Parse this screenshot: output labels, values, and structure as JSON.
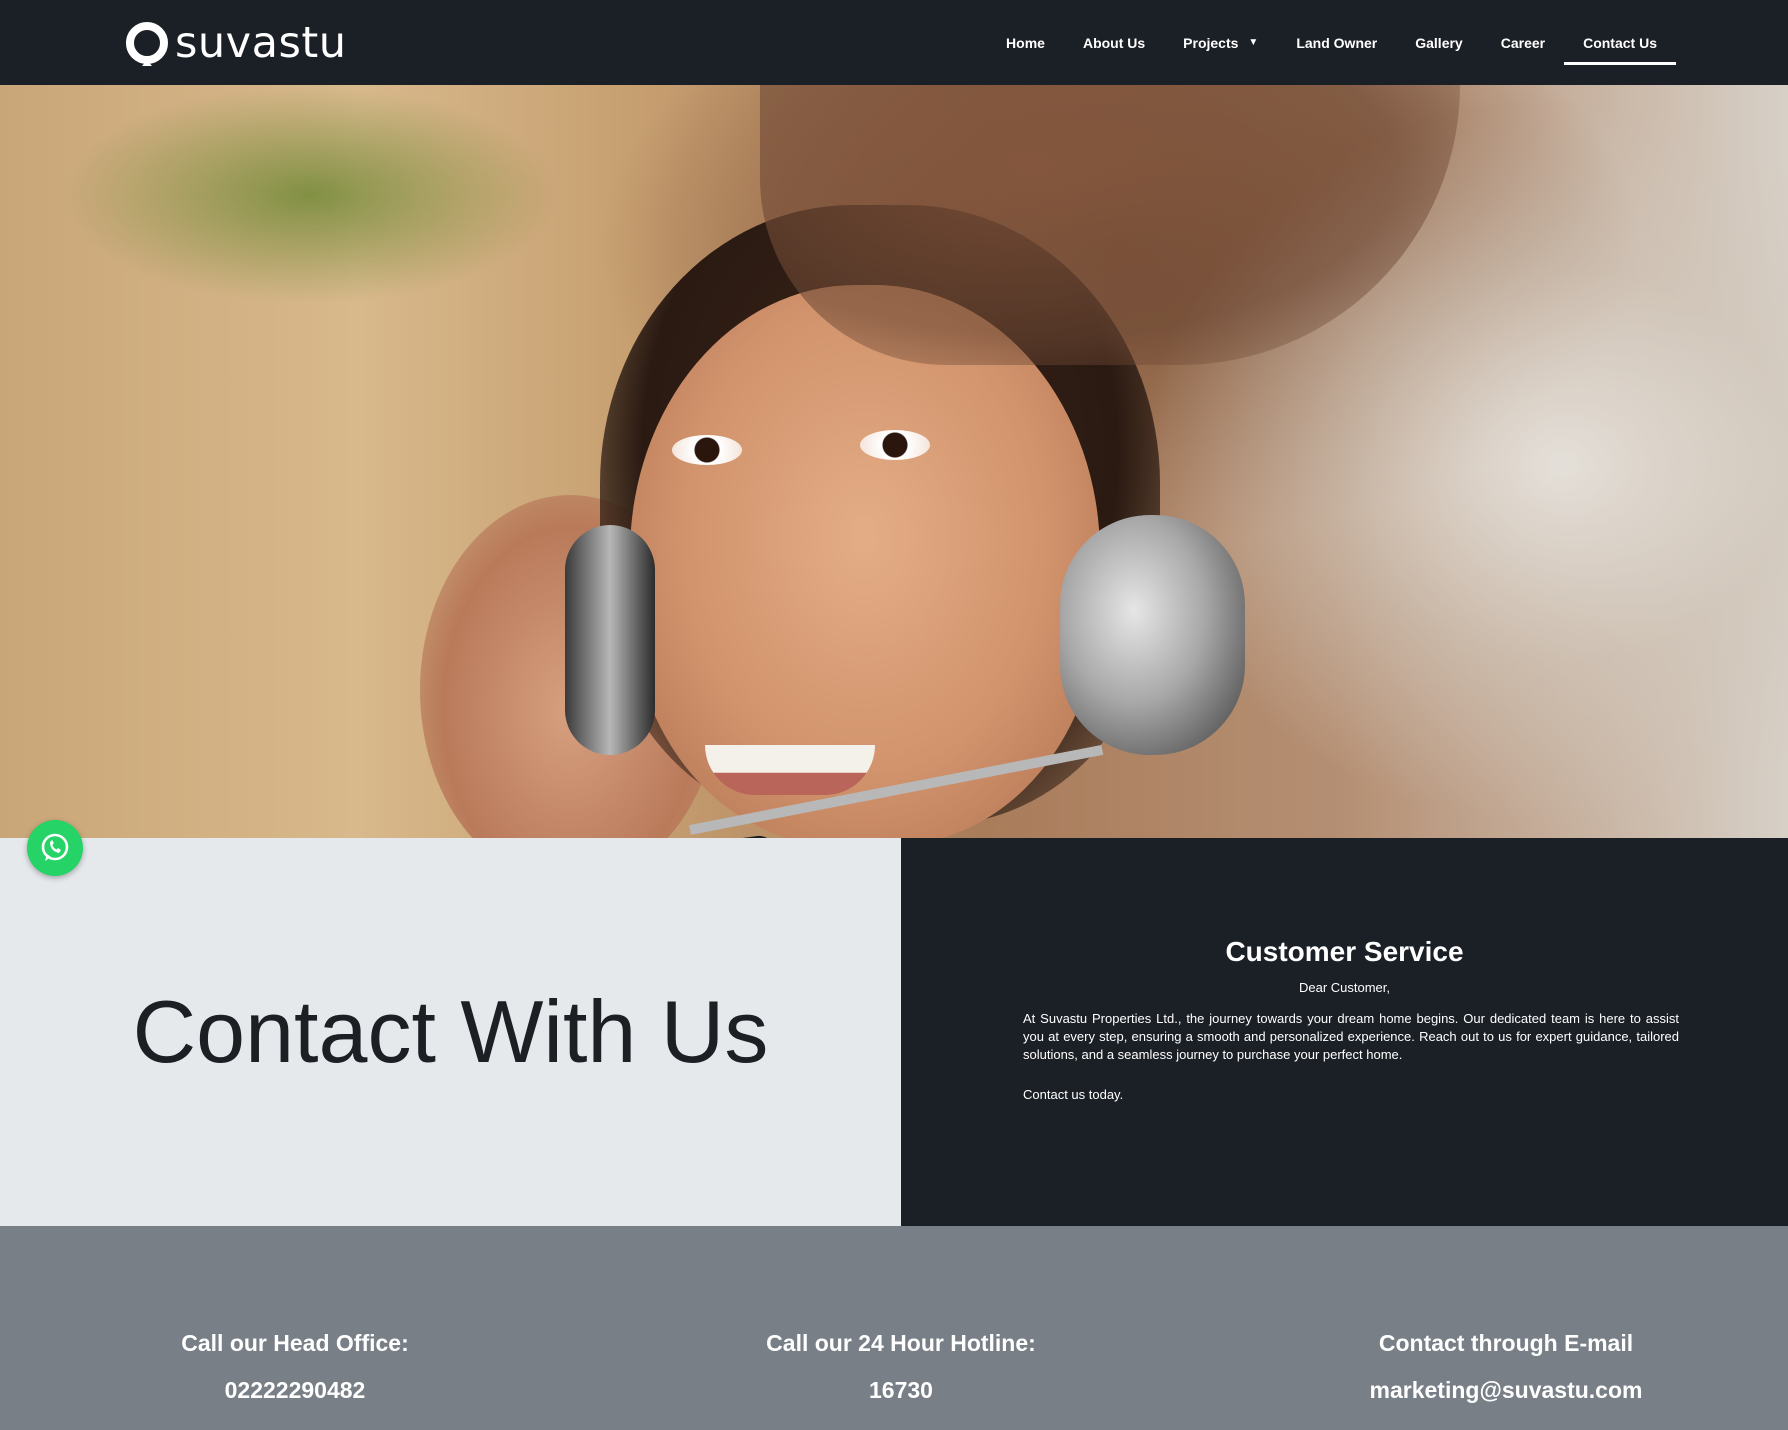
{
  "brand": {
    "name": "suvastu"
  },
  "nav": {
    "items": [
      {
        "label": "Home"
      },
      {
        "label": "About Us"
      },
      {
        "label": "Projects"
      },
      {
        "label": "Land Owner"
      },
      {
        "label": "Gallery"
      },
      {
        "label": "Career"
      },
      {
        "label": "Contact Us"
      }
    ],
    "active": "Contact Us"
  },
  "contact": {
    "heading": "Contact With Us"
  },
  "customer_service": {
    "title": "Customer Service",
    "greeting": "Dear Customer,",
    "body": "At Suvastu Properties Ltd., the journey towards your dream home begins. Our dedicated team is here to assist you at every step, ensuring a smooth and personalized experience. Reach out to us for expert guidance, tailored solutions, and a seamless journey to purchase your perfect home.",
    "cta": "Contact us today."
  },
  "info": {
    "head_office_label": "Call our Head Office:",
    "head_office_value": "02222290482",
    "hotline_label": "Call our 24 Hour Hotline:",
    "hotline_value": "16730",
    "email_label": "Contact through E-mail",
    "email_value": "marketing@suvastu.com"
  },
  "colors": {
    "header_bg": "#1b1f26",
    "contact_left_bg": "#e6e9ec",
    "info_band_bg": "#787f86",
    "whatsapp": "#25d366"
  },
  "icons": {
    "logo": "suvastu-logo-icon",
    "whatsapp": "whatsapp-icon",
    "dropdown": "caret-down-icon"
  }
}
